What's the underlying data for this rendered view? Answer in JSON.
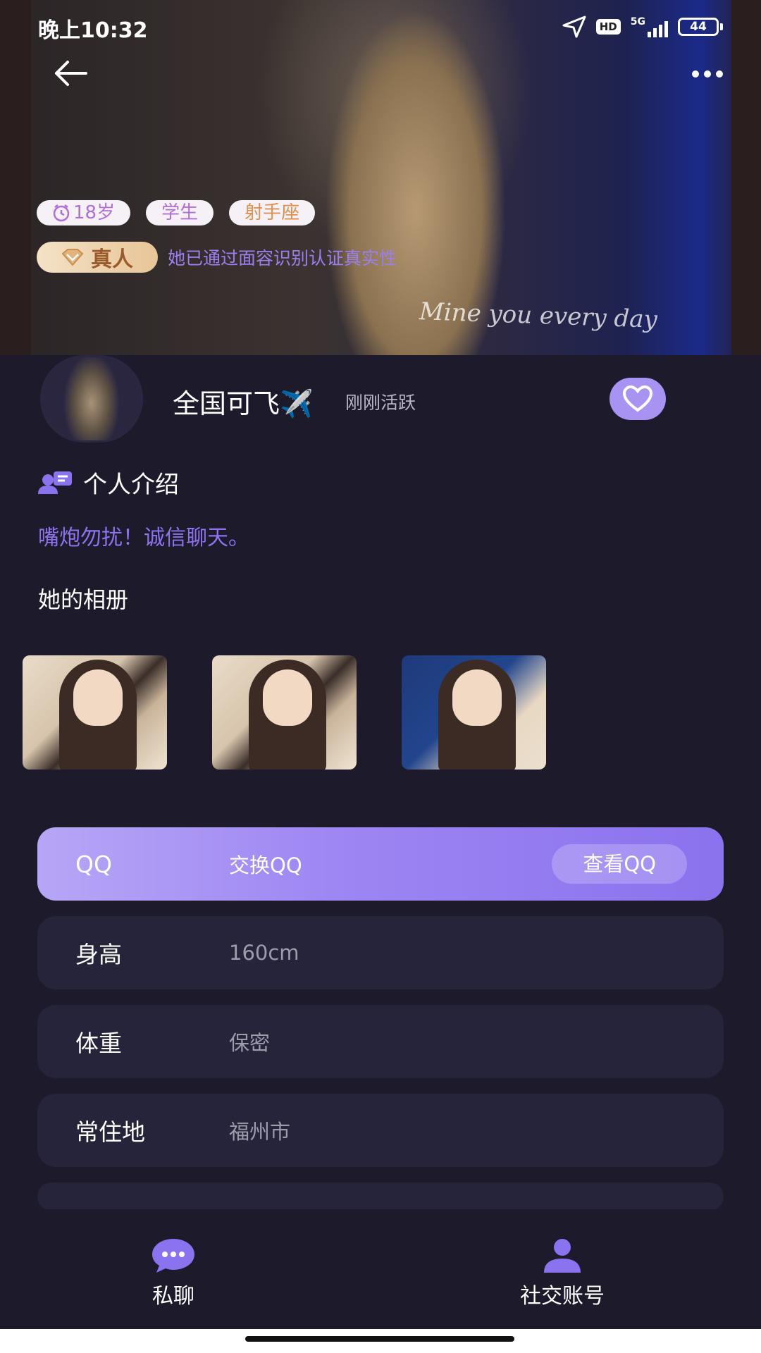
{
  "status_bar": {
    "time": "晚上10:32",
    "network": "5G",
    "hd": "HD",
    "battery": "44"
  },
  "hero": {
    "overlay_text": "Mine you every day"
  },
  "tags": [
    "18岁",
    "学生",
    "射手座"
  ],
  "verification": {
    "badge_label": "真人",
    "text": "她已通过面容识别认证真实性"
  },
  "profile": {
    "name": "全国可飞✈️",
    "active_status": "刚刚活跃"
  },
  "intro": {
    "title": "个人介绍",
    "text": "嘴炮勿扰！诚信聊天。"
  },
  "album": {
    "title": "她的相册"
  },
  "qq": {
    "label": "QQ",
    "value": "交换QQ",
    "button": "查看QQ"
  },
  "info": [
    {
      "label": "身高",
      "value": "160cm"
    },
    {
      "label": "体重",
      "value": "保密"
    },
    {
      "label": "常住地",
      "value": "福州市"
    }
  ],
  "tabs": {
    "chat": "私聊",
    "social": "社交账号"
  },
  "colors": {
    "accent": "#8b72ee",
    "background": "#1c1a2b",
    "card": "#26243a"
  }
}
